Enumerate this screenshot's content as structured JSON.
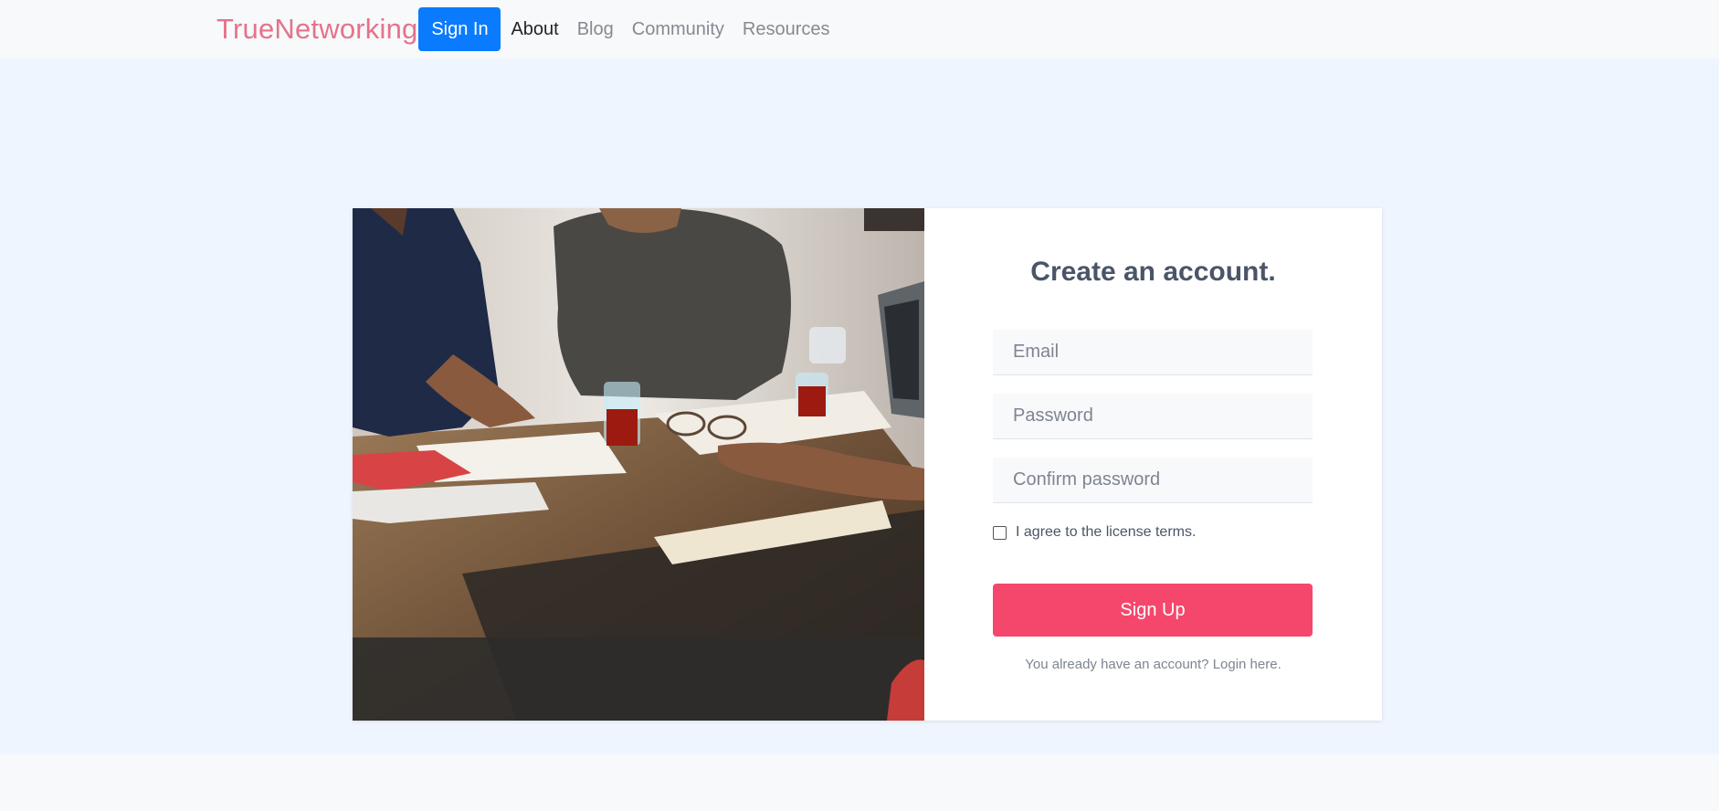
{
  "nav": {
    "brand": "TrueNetworking",
    "signin_label": "Sign In",
    "links": [
      "About",
      "Blog",
      "Community",
      "Resources"
    ]
  },
  "form": {
    "title": "Create an account.",
    "email_placeholder": "Email",
    "password_placeholder": "Password",
    "confirm_placeholder": "Confirm password",
    "agree_label": "I agree to the license terms.",
    "signup_label": "Sign Up",
    "login_prefix": "You already have an account? ",
    "login_link": "Login here."
  },
  "colors": {
    "brand": "#e5738a",
    "signin_button": "#0a7bff",
    "signup_button": "#f5476c",
    "hero_bg": "#eff5fe"
  },
  "image": {
    "subject": "people-at-table-photo"
  }
}
